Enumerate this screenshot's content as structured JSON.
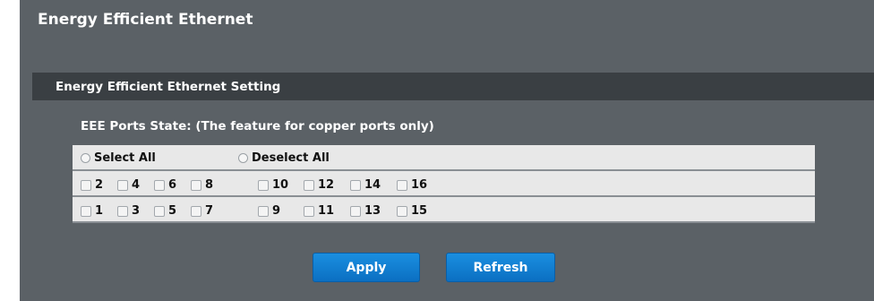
{
  "page": {
    "title": "Energy Efficient Ethernet"
  },
  "section": {
    "title": "Energy Efficient Ethernet Setting"
  },
  "eee": {
    "label": "EEE Ports State: (The feature for copper ports only)",
    "select_all": "Select All",
    "deselect_all": "Deselect All",
    "even_ports": [
      "2",
      "4",
      "6",
      "8",
      "10",
      "12",
      "14",
      "16"
    ],
    "odd_ports": [
      "1",
      "3",
      "5",
      "7",
      "9",
      "11",
      "13",
      "15"
    ]
  },
  "buttons": {
    "apply": "Apply",
    "refresh": "Refresh"
  },
  "colors": {
    "background": "#5b6166",
    "header": "#3a3f43",
    "button": "#0b6fc2"
  }
}
